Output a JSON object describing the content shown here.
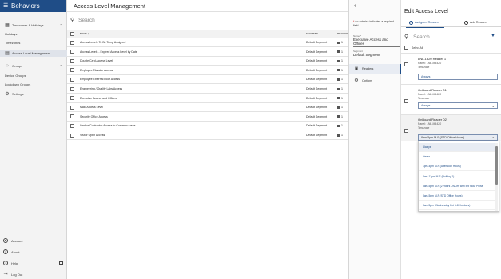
{
  "nav": {
    "app_title": "Behaviors",
    "items": [
      {
        "label": "Timezones & Holidays",
        "expanded": true
      },
      {
        "label": "Holidays"
      },
      {
        "label": "Timezones"
      },
      {
        "label": "Access Level Management"
      },
      {
        "label": "Groups",
        "expanded": true
      },
      {
        "label": "Device Groups"
      },
      {
        "label": "Lockdown Groups"
      },
      {
        "label": "Settings"
      }
    ],
    "bottom": [
      {
        "label": "Account"
      },
      {
        "label": "About"
      },
      {
        "label": "Help"
      },
      {
        "label": "Log Out"
      }
    ]
  },
  "main": {
    "title": "Access Level Management",
    "search_placeholder": "Search",
    "columns": {
      "name": "NAME ∨",
      "segment": "SEGMENT",
      "readers": "READERS"
    },
    "rows": [
      {
        "name": "Access Level - To Be Temp Assigned",
        "segment": "Default Segment",
        "readers": "1"
      },
      {
        "name": "Access Levels - Expired Access Level by Date",
        "segment": "Default Segment",
        "readers": "1"
      },
      {
        "name": "Double Card Access Level",
        "segment": "Default Segment",
        "readers": "1"
      },
      {
        "name": "Employee Elevator Access",
        "segment": "Default Segment",
        "readers": "1"
      },
      {
        "name": "Employee External Door Access",
        "segment": "Default Segment",
        "readers": "1"
      },
      {
        "name": "Engineering / Quality Labs Access",
        "segment": "Default Segment",
        "readers": "1"
      },
      {
        "name": "Executive Access and Offices",
        "segment": "Default Segment",
        "readers": "1"
      },
      {
        "name": "Main Access Level",
        "segment": "Default Segment",
        "readers": "1"
      },
      {
        "name": "Security Office Access",
        "segment": "Default Segment",
        "readers": "1"
      },
      {
        "name": "Vendor/Contractor Access to Common Areas",
        "segment": "Default Segment",
        "readers": "1"
      },
      {
        "name": "Visitor Open Access",
        "segment": "Default Segment",
        "readers": "1"
      }
    ]
  },
  "panel": {
    "title": "Edit Access Level",
    "required_note": "An asterisk indicates a required field",
    "name_label": "Name *",
    "name_value": "Executive Access and Offices",
    "segment_label": "Segment",
    "segment_value": "Default Segment",
    "sections": [
      {
        "label": "Readers"
      },
      {
        "label": "Options"
      }
    ],
    "tabs": {
      "assigned": "Assigned Readers",
      "add": "Add Readers"
    },
    "search_placeholder": "Search",
    "select_all": "Select All",
    "readers": [
      {
        "name": "LNL-1320 Reader 1",
        "panel": "Panel: LNL-M4420",
        "tz_label": "Timezone",
        "tz_value": "Always"
      },
      {
        "name": "OnBoard Reader 01",
        "panel": "Panel: LNL-M4420",
        "tz_label": "Timezone",
        "tz_value": "Always"
      },
      {
        "name": "OnBoard Reader 02",
        "panel": "Panel: LNL-M4420",
        "tz_label": "Timezone",
        "tz_value": "8am-5pm M-F (STD Office Hours)"
      }
    ],
    "dropdown_options": [
      "Always",
      "Never",
      "1pm-4pm M-F (Afternoon Hours)",
      "8am-12pm M-F (Holiday 1)",
      "8am-5pm M-F (2 Hours On/Off) with M9 Hour Pulse",
      "8am-5pm M-F (STD Office Hours)",
      "8am-5pm (Wednesday Ext 6-8 Holidays)"
    ]
  }
}
